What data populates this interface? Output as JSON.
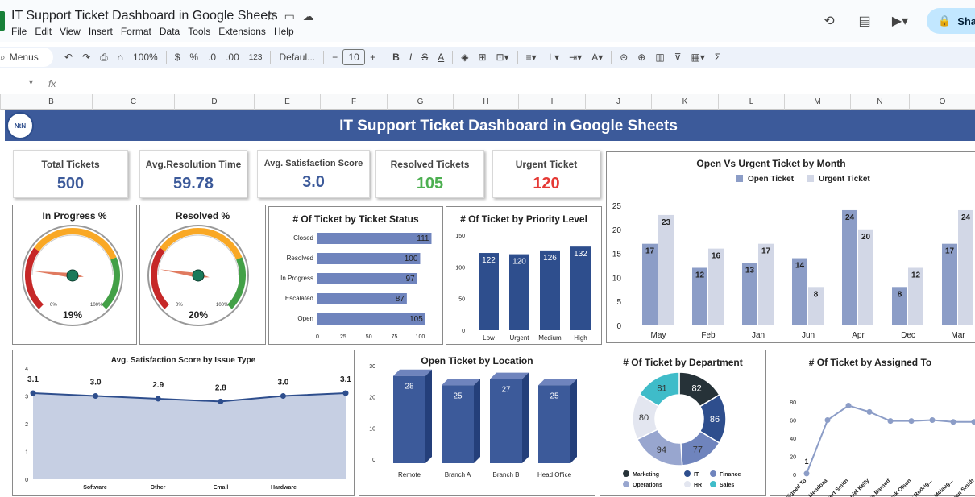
{
  "window": {
    "doc_title": "IT Support Ticket Dashboard in Google Sheets",
    "share_label": "Sha"
  },
  "menu": [
    "File",
    "Edit",
    "View",
    "Insert",
    "Format",
    "Data",
    "Tools",
    "Extensions",
    "Help"
  ],
  "toolbar": {
    "search": "Menus",
    "zoom": "100%",
    "currency": "$",
    "percent": "%",
    "dec_dec": ".0",
    "inc_dec": ".00",
    "num_format": "123",
    "font": "Defaul...",
    "font_size": "10",
    "bold": "B",
    "italic": "I",
    "sum": "Σ"
  },
  "columns": [
    "B",
    "C",
    "D",
    "E",
    "F",
    "G",
    "H",
    "I",
    "J",
    "K",
    "L",
    "M",
    "N",
    "O"
  ],
  "dashboard": {
    "banner_title": "IT Support Ticket Dashboard in Google Sheets",
    "logo_text": "NtN",
    "kpis": [
      {
        "label": "Total Tickets",
        "value": "500",
        "color": "#3c5a9a"
      },
      {
        "label": "Avg.Resolution Time",
        "value": "59.78",
        "color": "#3c5a9a"
      },
      {
        "label": "Avg. Satisfaction Score",
        "value": "3.0",
        "color": "#3c5a9a"
      },
      {
        "label": "Resolved Tickets",
        "value": "105",
        "color": "#4caf50"
      },
      {
        "label": "Urgent Ticket",
        "value": "120",
        "color": "#e53935"
      }
    ]
  },
  "chart_data": [
    {
      "type": "gauge",
      "title": "In Progress %",
      "value": 19,
      "value_label": "19%",
      "min_label": "0%",
      "max_label": "100%"
    },
    {
      "type": "gauge",
      "title": "Resolved %",
      "value": 20,
      "value_label": "20%",
      "min_label": "0%",
      "max_label": "100%"
    },
    {
      "type": "bar",
      "orientation": "horizontal",
      "title": "# Of Ticket by Ticket Status",
      "categories": [
        "Closed",
        "Resolved",
        "In Progress",
        "Escalated",
        "Open"
      ],
      "values": [
        111,
        100,
        97,
        87,
        105
      ],
      "xlim": [
        0,
        100
      ],
      "ticks": [
        "0",
        "25",
        "50",
        "75",
        "100"
      ]
    },
    {
      "type": "bar",
      "title": "# Of Ticket by Priority Level",
      "categories": [
        "Low",
        "Urgent",
        "Medium",
        "High"
      ],
      "values": [
        122,
        120,
        126,
        132
      ],
      "ylim": [
        0,
        150
      ],
      "ticks": [
        "0",
        "50",
        "100",
        "150"
      ]
    },
    {
      "type": "bar",
      "title": "Open Vs Urgent Ticket by Month",
      "categories": [
        "May",
        "Feb",
        "Jan",
        "Jun",
        "Apr",
        "Dec",
        "Mar"
      ],
      "series": [
        {
          "name": "Open Ticket",
          "values": [
            17,
            12,
            13,
            14,
            24,
            8,
            17
          ],
          "color": "#8c9dc7"
        },
        {
          "name": "Urgent Ticket",
          "values": [
            23,
            16,
            17,
            8,
            20,
            12,
            24
          ],
          "color": "#d2d7e6"
        }
      ],
      "ylim": [
        0,
        25
      ],
      "ticks": [
        "0",
        "5",
        "10",
        "15",
        "20",
        "25"
      ],
      "legend": "top"
    },
    {
      "type": "area",
      "title": "Avg. Satisfaction Score by Issue Type",
      "categories": [
        "Software",
        "Other",
        "Email",
        "Hardware"
      ],
      "values": [
        3.1,
        3.0,
        2.9,
        2.8,
        3.0,
        3.1
      ],
      "value_labels": [
        "3.1",
        "3.0",
        "2.9",
        "2.8",
        "3.0",
        "3.1"
      ],
      "ylim": [
        0,
        4
      ],
      "ticks": [
        "0",
        "1",
        "2",
        "3",
        "4"
      ]
    },
    {
      "type": "bar",
      "title": "Open Ticket by Location",
      "categories": [
        "Remote",
        "Branch A",
        "Branch B",
        "Head Office"
      ],
      "values": [
        28,
        25,
        27,
        25
      ],
      "ylim": [
        0,
        30
      ],
      "ticks": [
        "0",
        "10",
        "20",
        "30"
      ]
    },
    {
      "type": "pie",
      "title": "# Of Ticket by Department",
      "categories": [
        "Marketing",
        "IT",
        "Finance",
        "Operations",
        "HR",
        "Sales"
      ],
      "values": [
        82,
        86,
        77,
        94,
        80,
        81
      ],
      "colors": [
        "#263238",
        "#2e4e8d",
        "#6f84bd",
        "#98a6cf",
        "#e3e6f0",
        "#3fbcc9"
      ],
      "legend": "bottom"
    },
    {
      "type": "line",
      "title": "# Of Ticket by Assigned To",
      "categories": [
        "Assigned To",
        "Mark Mendoza",
        "Robert Smith",
        "Daniel Kelly",
        "James Barnett",
        "Frank Olson",
        "Hannah Rodrig...",
        "Phillip Mclaug...",
        "Susan Smith"
      ],
      "values": [
        1,
        60,
        76,
        69,
        59,
        59,
        60,
        58,
        58
      ],
      "first_label": "1",
      "ylim": [
        0,
        80
      ],
      "ticks": [
        "0",
        "20",
        "40",
        "60",
        "80"
      ]
    }
  ]
}
